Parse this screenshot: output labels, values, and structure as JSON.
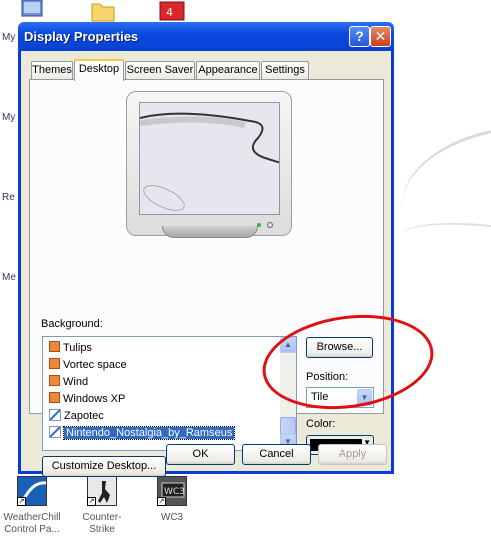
{
  "desktop": {
    "side_labels": [
      "My",
      "My",
      "Re",
      "Me"
    ],
    "bottom_icons": [
      {
        "name": "WeatherChill Control Pa...",
        "line1": "WeatherChill",
        "line2": "Control Pa..."
      },
      {
        "name": "Counter-Strike",
        "line1": "Counter-Strike",
        "line2": ""
      },
      {
        "name": "WC3",
        "line1": "WC3",
        "line2": ""
      }
    ]
  },
  "window": {
    "title": "Display Properties",
    "help_label": "?",
    "close_label": "✕"
  },
  "tabs": [
    {
      "label": "Themes"
    },
    {
      "label": "Desktop"
    },
    {
      "label": "Screen Saver"
    },
    {
      "label": "Appearance"
    },
    {
      "label": "Settings"
    }
  ],
  "desktop_tab": {
    "background_label": "Background:",
    "backgrounds": [
      {
        "label": "Tulips"
      },
      {
        "label": "Vortec space"
      },
      {
        "label": "Wind"
      },
      {
        "label": "Windows XP"
      },
      {
        "label": "Zapotec"
      },
      {
        "label": "Nintendo_Nostalgia_by_Ramseus"
      }
    ],
    "browse_label": "Browse...",
    "position_label": "Position:",
    "position_value": "Tile",
    "color_label": "Color:",
    "color_value": "#000000",
    "customize_label": "Customize Desktop..."
  },
  "footer": {
    "ok_label": "OK",
    "cancel_label": "Cancel",
    "apply_label": "Apply"
  }
}
